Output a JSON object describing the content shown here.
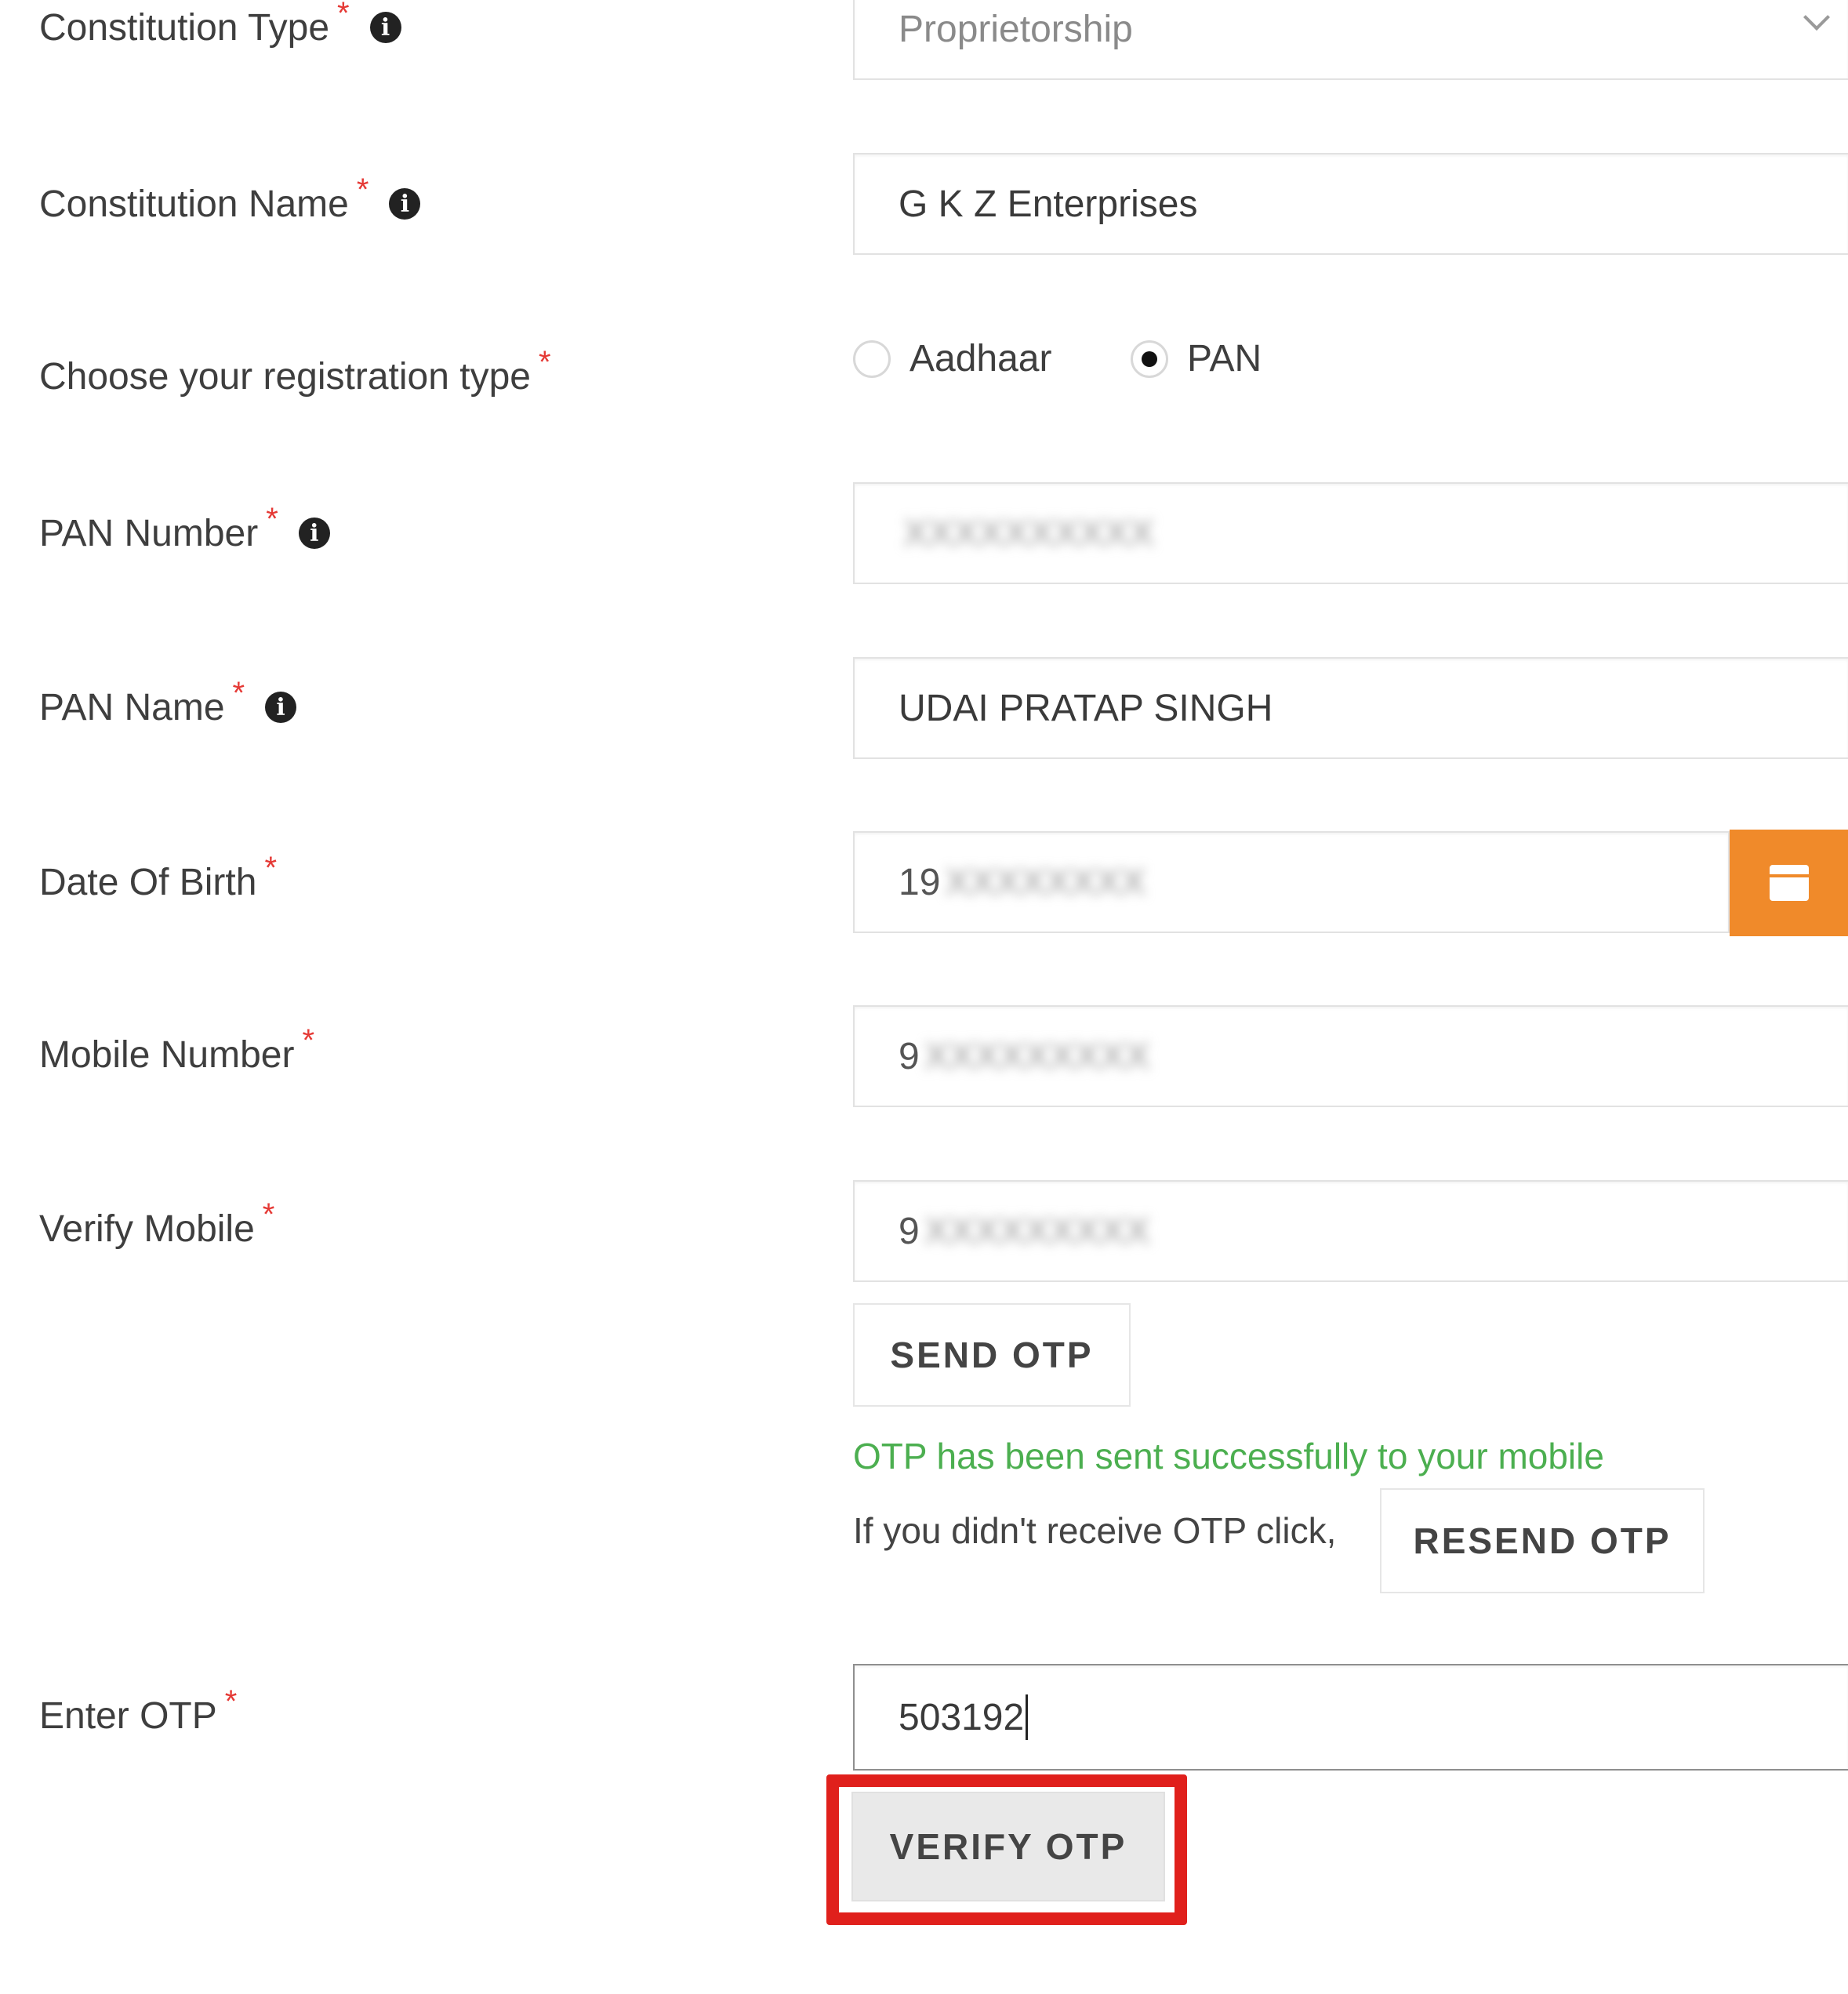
{
  "form": {
    "constitution_type": {
      "label": "Constitution Type",
      "value": "Proprietorship"
    },
    "constitution_name": {
      "label": "Constitution Name",
      "value": "G K Z Enterprises"
    },
    "registration_type": {
      "label": "Choose your registration type",
      "options": [
        "Aadhaar",
        "PAN"
      ],
      "selected": "PAN"
    },
    "pan_number": {
      "label": "PAN Number",
      "value_masked": "XXXXXXXXXX"
    },
    "pan_name": {
      "label": "PAN Name",
      "value": "UDAI PRATAP SINGH"
    },
    "date_of_birth": {
      "label": "Date Of Birth",
      "visible_prefix": "19",
      "value_masked": "XXXXXXXX"
    },
    "mobile_number": {
      "label": "Mobile Number",
      "visible_prefix": "9",
      "value_masked": "XXXXXXXXX"
    },
    "verify_mobile": {
      "label": "Verify Mobile",
      "visible_prefix": "9",
      "value_masked": "XXXXXXXXX"
    },
    "send_otp_label": "SEND OTP",
    "otp_success_message": "OTP has been sent successfully to your mobile",
    "resend_prompt": "If you didn't receive OTP click,",
    "resend_otp_label": "RESEND OTP",
    "enter_otp": {
      "label": "Enter OTP",
      "value": "503192"
    },
    "verify_otp_label": "VERIFY OTP",
    "required_marker": "*",
    "info_glyph": "i"
  },
  "colors": {
    "accent": "#f08a2a",
    "success": "#4caf50",
    "required": "#e53935",
    "highlight": "#e0201c"
  },
  "icons": {
    "info": "info-icon",
    "dropdown": "chevron-down-icon",
    "calendar": "calendar-icon"
  }
}
